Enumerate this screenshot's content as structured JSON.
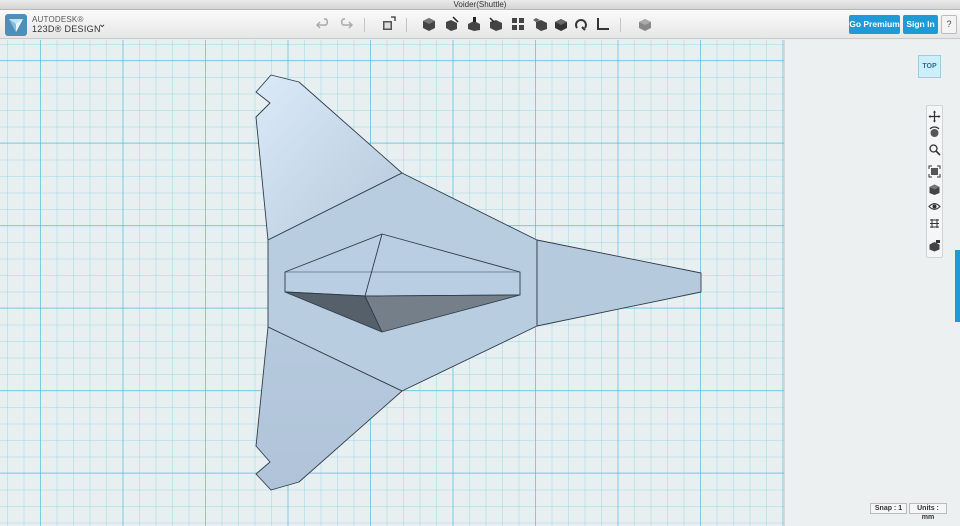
{
  "window": {
    "title": "Voider(Shuttle)"
  },
  "brand": {
    "line1": "AUTODESK®",
    "line2": "123D® DESIGN",
    "menu_caret": "⌄"
  },
  "toolbar": {
    "tools": [
      "undo-icon",
      "redo-icon",
      "transform-icon",
      "primitives-icon",
      "sketch-icon",
      "construct-icon",
      "modify-icon",
      "pattern-icon",
      "grouping-icon",
      "snap-icon",
      "combine-icon",
      "measure-icon",
      "material-icon"
    ],
    "go_premium_label": "Go Premium",
    "sign_in_label": "Sign In",
    "help_label": "?"
  },
  "viewcube": {
    "label": "TOP"
  },
  "navigation": {
    "tools": [
      "pan-icon",
      "orbit-icon",
      "zoom-icon",
      "fit-icon",
      "view-mode-icon",
      "visibility-icon",
      "grid-icon",
      "material-view-icon"
    ]
  },
  "statusbar": {
    "snap_label": "Snap : 1",
    "units_label": "Units : mm"
  },
  "colors": {
    "accent": "#1e9ad6",
    "model_fill": "#b8cde0",
    "grid_line": "#5fc8e1"
  }
}
